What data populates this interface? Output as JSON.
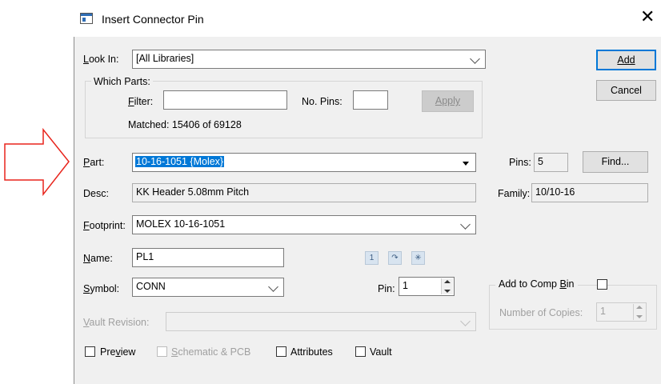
{
  "dialog": {
    "title": "Insert Connector Pin",
    "close_glyph": "✕"
  },
  "look_in": {
    "label": "Look In:",
    "value": "[All Libraries]"
  },
  "which_parts": {
    "label": "Which Parts:",
    "filter_label": "Filter:",
    "filter_value": "",
    "no_pins_label": "No. Pins:",
    "no_pins_value": "",
    "apply_label": "Apply",
    "matched_text": "Matched: 15406 of 69128"
  },
  "buttons": {
    "add": "Add",
    "cancel": "Cancel",
    "find": "Find..."
  },
  "part": {
    "label": "Part:",
    "value": "10-16-1051 {Molex}"
  },
  "pins": {
    "label": "Pins:",
    "value": "5"
  },
  "desc": {
    "label": "Desc:",
    "value": "KK Header 5.08mm Pitch"
  },
  "family": {
    "label": "Family:",
    "value": "10/10-16"
  },
  "footprint": {
    "label": "Footprint:",
    "value": "MOLEX 10-16-1051"
  },
  "name": {
    "label": "Name:",
    "value": "PL1"
  },
  "name_tools": {
    "number_glyph": "1",
    "rotate_glyph": "↷",
    "star_glyph": "✳"
  },
  "symbol": {
    "label": "Symbol:",
    "value": "CONN"
  },
  "pin": {
    "label": "Pin:",
    "value": "1"
  },
  "comp_bin": {
    "label": "Add to Comp Bin",
    "copies_label": "Number of Copies:",
    "copies_value": "1"
  },
  "vault_revision": {
    "label": "Vault Revision:",
    "value": ""
  },
  "options": {
    "preview": "Preview",
    "schematic_pcb": "Schematic & PCB",
    "attributes": "Attributes",
    "vault": "Vault"
  },
  "colors": {
    "arrow": "#e8241c",
    "selection": "#0078d7",
    "default_button_border": "#0078d7"
  },
  "icons": {
    "arrow": "right-arrow-icon",
    "app": "window-icon",
    "close": "close-icon"
  }
}
